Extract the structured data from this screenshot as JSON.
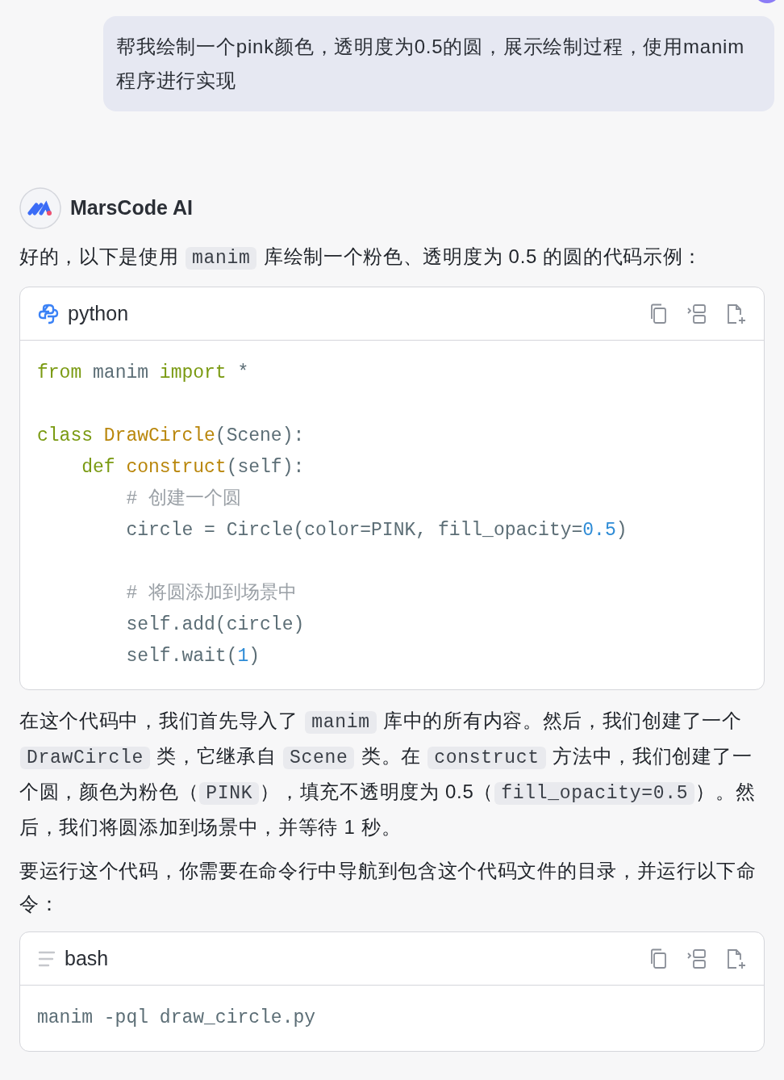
{
  "user_message": {
    "text": "帮我绘制一个pink颜色，透明度为0.5的圆，展示绘制过程，使用manim程序进行实现"
  },
  "assistant": {
    "name": "MarsCode AI"
  },
  "content": [
    {
      "kind": "paragraph",
      "parts": [
        {
          "kind": "text",
          "text": "好的，以下是使用 "
        },
        {
          "kind": "code",
          "text": "manim"
        },
        {
          "kind": "text",
          "text": " 库绘制一个粉色、透明度为 0.5 的圆的代码示例："
        }
      ]
    },
    {
      "kind": "python",
      "language": "python",
      "groups": [
        [
          [
            {
              "kind": "keyword",
              "text": "from"
            },
            {
              "kind": "plain",
              "text": " manim "
            },
            {
              "kind": "keyword",
              "text": "import"
            },
            {
              "kind": "plain",
              "text": " *"
            }
          ]
        ],
        [
          [
            {
              "kind": "keyword",
              "text": "class"
            },
            {
              "kind": "name",
              "text": " DrawCircle"
            },
            {
              "kind": "plain",
              "text": "(Scene):"
            }
          ],
          [
            {
              "kind": "keyword",
              "text": "    def"
            },
            {
              "kind": "name",
              "text": " construct"
            },
            {
              "kind": "plain",
              "text": "(self):"
            }
          ],
          [
            {
              "kind": "comment",
              "text": "        # 创建一个圆"
            }
          ],
          [
            {
              "kind": "plain",
              "text": "        circle = Circle(color=PINK, fill_opacity="
            },
            {
              "kind": "number",
              "text": "0.5"
            },
            {
              "kind": "plain",
              "text": ")"
            }
          ]
        ],
        [
          [
            {
              "kind": "comment",
              "text": "        # 将圆添加到场景中"
            }
          ],
          [
            {
              "kind": "plain",
              "text": "        self.add(circle)"
            }
          ],
          [
            {
              "kind": "plain",
              "text": "        self.wait("
            },
            {
              "kind": "number",
              "text": "1"
            },
            {
              "kind": "plain",
              "text": ")"
            }
          ]
        ]
      ]
    },
    {
      "kind": "paragraph",
      "parts": [
        {
          "kind": "text",
          "text": "在这个代码中，我们首先导入了 "
        },
        {
          "kind": "code",
          "text": "manim"
        },
        {
          "kind": "text",
          "text": " 库中的所有内容。然后，我们创建了一个 "
        },
        {
          "kind": "code",
          "text": "DrawCircle"
        },
        {
          "kind": "text",
          "text": " 类，它继承自 "
        },
        {
          "kind": "code",
          "text": "Scene"
        },
        {
          "kind": "text",
          "text": " 类。在 "
        },
        {
          "kind": "code",
          "text": "construct"
        },
        {
          "kind": "text",
          "text": " 方法中，我们创建了一个圆，颜色为粉色（"
        },
        {
          "kind": "code",
          "text": "PINK"
        },
        {
          "kind": "text",
          "text": "），填充不透明度为 0.5（"
        },
        {
          "kind": "code",
          "text": "fill_opacity=0.5"
        },
        {
          "kind": "text",
          "text": "）。然后，我们将圆添加到场景中，并等待 1 秒。"
        }
      ]
    },
    {
      "kind": "paragraph",
      "parts": [
        {
          "kind": "text",
          "text": "要运行这个代码，你需要在命令行中导航到包含这个代码文件的目录，并运行以下命令："
        }
      ]
    },
    {
      "kind": "shell",
      "language": "bash",
      "groups": [
        [
          [
            {
              "kind": "plain",
              "text": "manim -pql draw_circle.py"
            }
          ]
        ]
      ]
    }
  ]
}
